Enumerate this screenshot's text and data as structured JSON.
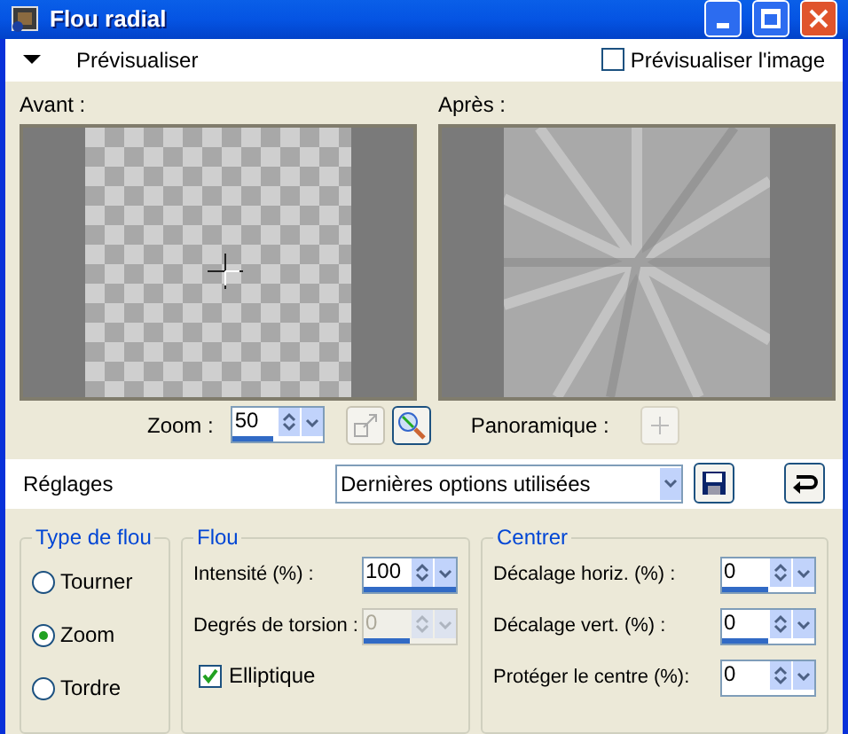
{
  "window": {
    "title": "Flou radial"
  },
  "preview_bar": {
    "label": "Prévisualiser",
    "expanded": true,
    "preview_image": {
      "label": "Prévisualiser l'image",
      "checked": false
    }
  },
  "before": {
    "label": "Avant :"
  },
  "after": {
    "label": "Après :"
  },
  "zoom": {
    "label": "Zoom :",
    "value": "50",
    "level": 0.45
  },
  "pan": {
    "label": "Panoramique :"
  },
  "presets": {
    "label": "Réglages",
    "value": "Dernières options utilisées"
  },
  "blur_type": {
    "title": "Type de flou",
    "options": [
      {
        "label": "Tourner",
        "selected": false
      },
      {
        "label": "Zoom",
        "selected": true
      },
      {
        "label": "Tordre",
        "selected": false
      }
    ]
  },
  "blur": {
    "title": "Flou",
    "fields": [
      {
        "label": "Intensité (%) :",
        "value": "100",
        "level": 1.0,
        "disabled": false
      },
      {
        "label": "Degrés de torsion :",
        "value": "0",
        "level": 0.5,
        "disabled": true
      }
    ],
    "elliptical": {
      "label": "Elliptique",
      "checked": true
    }
  },
  "center": {
    "title": "Centrer",
    "fields": [
      {
        "label": "Décalage horiz. (%) :",
        "value": "0",
        "level": 0.5,
        "disabled": false
      },
      {
        "label": "Décalage vert. (%) :",
        "value": "0",
        "level": 0.5,
        "disabled": false
      },
      {
        "label": "Protéger le centre (%):",
        "value": "0",
        "disabled": false
      }
    ]
  }
}
